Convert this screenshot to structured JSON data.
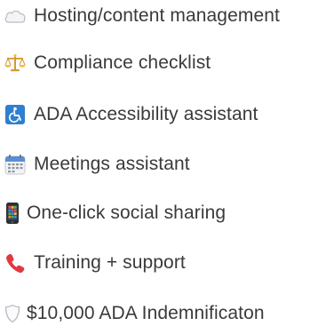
{
  "features": [
    {
      "label": "Hosting/content management",
      "icon": "cloud-icon"
    },
    {
      "label": "Compliance checklist",
      "icon": "scales-icon"
    },
    {
      "label": "ADA Accessibility assistant",
      "icon": "wheelchair-icon"
    },
    {
      "label": "Meetings assistant",
      "icon": "calendar-icon"
    },
    {
      "label": "One-click social sharing",
      "icon": "mobile-phone-icon"
    },
    {
      "label": "Training + support",
      "icon": "telephone-receiver-icon"
    },
    {
      "label": "$10,000 ADA Indemnificaton",
      "icon": "shield-icon"
    }
  ],
  "colors": {
    "text": "#3a3a3a",
    "accessibility_blue": "#2f7fd1",
    "phone_red": "#e0393e",
    "scales_gold": "#e2a93b"
  }
}
